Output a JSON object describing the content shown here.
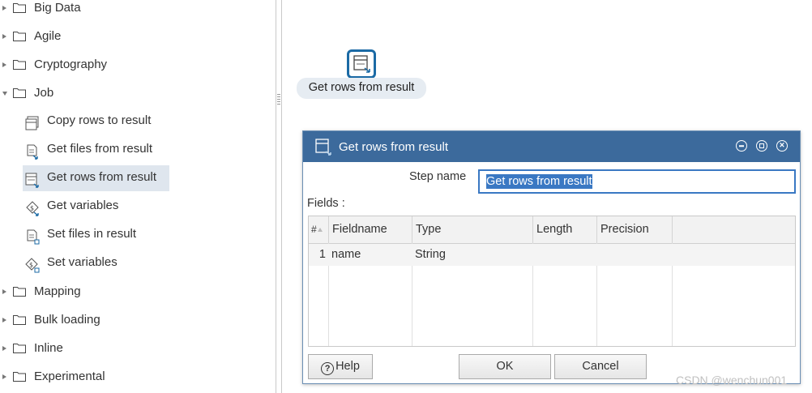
{
  "tree": {
    "categories_top": [
      {
        "label": "Big Data",
        "expanded": false
      },
      {
        "label": "Agile",
        "expanded": false
      },
      {
        "label": "Cryptography",
        "expanded": false
      },
      {
        "label": "Job",
        "expanded": true
      }
    ],
    "job_children": [
      {
        "label": "Copy rows to result",
        "icon": "copy-rows-icon"
      },
      {
        "label": "Get files from result",
        "icon": "get-files-icon"
      },
      {
        "label": "Get rows from result",
        "icon": "get-rows-icon",
        "selected": true
      },
      {
        "label": "Get variables",
        "icon": "get-variables-icon"
      },
      {
        "label": "Set files in result",
        "icon": "set-files-icon"
      },
      {
        "label": "Set variables",
        "icon": "set-variables-icon"
      }
    ],
    "categories_bottom": [
      {
        "label": "Mapping",
        "expanded": false
      },
      {
        "label": "Bulk loading",
        "expanded": false
      },
      {
        "label": "Inline",
        "expanded": false
      },
      {
        "label": "Experimental",
        "expanded": false
      }
    ]
  },
  "canvas": {
    "step_label": "Get rows from result",
    "step_icon": "get-rows-icon"
  },
  "dialog": {
    "title": "Get rows from result",
    "step_name_label": "Step name",
    "step_name_value": "Get rows from result",
    "fields_label": "Fields :",
    "columns": [
      "#",
      "Fieldname",
      "Type",
      "Length",
      "Precision"
    ],
    "rows": [
      {
        "num": "1",
        "fieldname": "name",
        "type": "String",
        "length": "",
        "precision": ""
      }
    ],
    "help_label": "Help",
    "ok_label": "OK",
    "cancel_label": "Cancel"
  },
  "watermark": "CSDN @wenchun001",
  "colors": {
    "title_bar": "#3c6a9c",
    "selection": "#3a78c3",
    "selected_item": "#dfe6ee",
    "step_icon_border": "#1b6aa5"
  }
}
